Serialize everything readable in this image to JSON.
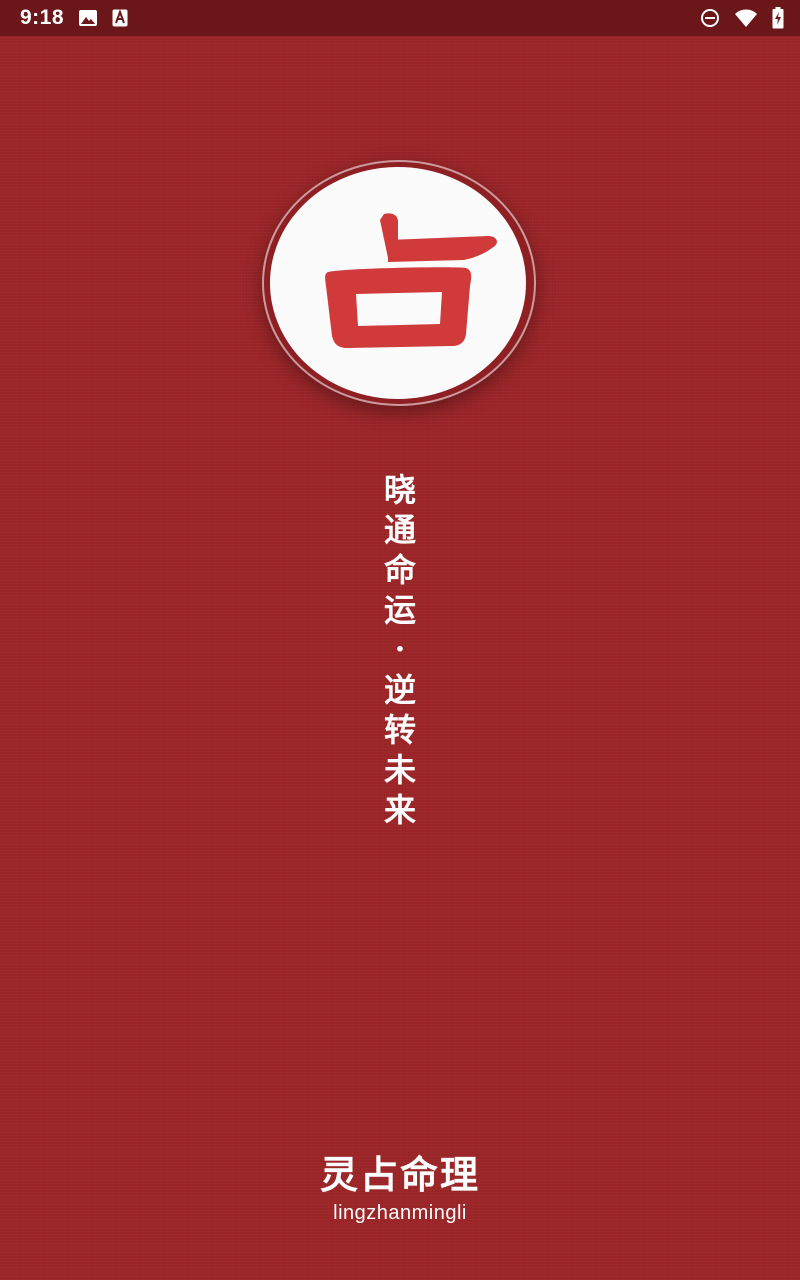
{
  "status_bar": {
    "time": "9:18",
    "left_icons": [
      "image-icon",
      "font-a-icon"
    ],
    "right_icons": [
      "do-not-disturb-icon",
      "wifi-icon",
      "battery-charging-icon"
    ]
  },
  "logo": {
    "character": "占",
    "icon": "zhan-character-logo-icon",
    "character_color": "#d13a3b"
  },
  "slogan": {
    "first_line": [
      "晓",
      "通",
      "命",
      "运"
    ],
    "separator": "·",
    "second_line": [
      "逆",
      "转",
      "未",
      "来"
    ]
  },
  "brand": {
    "name": "灵占命理",
    "pinyin": "lingzhanmingli"
  },
  "colors": {
    "background": "#9c2528",
    "status_bar": "#6b1719",
    "logo_red": "#d13a3b",
    "text": "#ffffff"
  }
}
